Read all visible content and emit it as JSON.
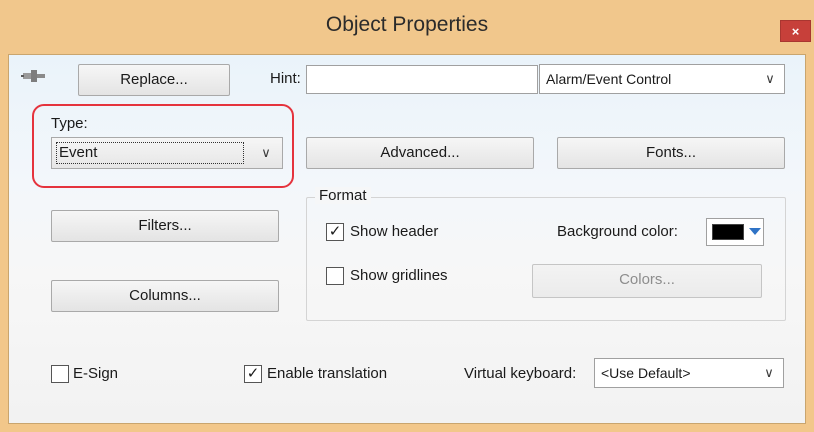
{
  "window": {
    "title": "Object Properties",
    "close_glyph": "×"
  },
  "toolbar": {
    "pin_icon": "pushpin-icon",
    "replace_label": "Replace...",
    "hint_label": "Hint:",
    "hint_value": "",
    "object_type_value": "Alarm/Event Control"
  },
  "type_section": {
    "label": "Type:",
    "value": "Event"
  },
  "buttons": {
    "advanced": "Advanced...",
    "fonts": "Fonts...",
    "filters": "Filters...",
    "columns": "Columns...",
    "colors": "Colors..."
  },
  "format": {
    "title": "Format",
    "show_header": {
      "label": "Show header",
      "checked": true
    },
    "show_gridlines": {
      "label": "Show gridlines",
      "checked": false
    },
    "background_color_label": "Background color:",
    "background_color_value": "#000000"
  },
  "footer": {
    "esign": {
      "label": "E-Sign",
      "checked": false
    },
    "enable_translation": {
      "label": "Enable translation",
      "checked": true
    },
    "virtual_keyboard_label": "Virtual keyboard:",
    "virtual_keyboard_value": "<Use Default>"
  },
  "colors": {
    "highlight": "#e5333d",
    "titlebar": "#f1c78c",
    "close": "#c7403a"
  }
}
